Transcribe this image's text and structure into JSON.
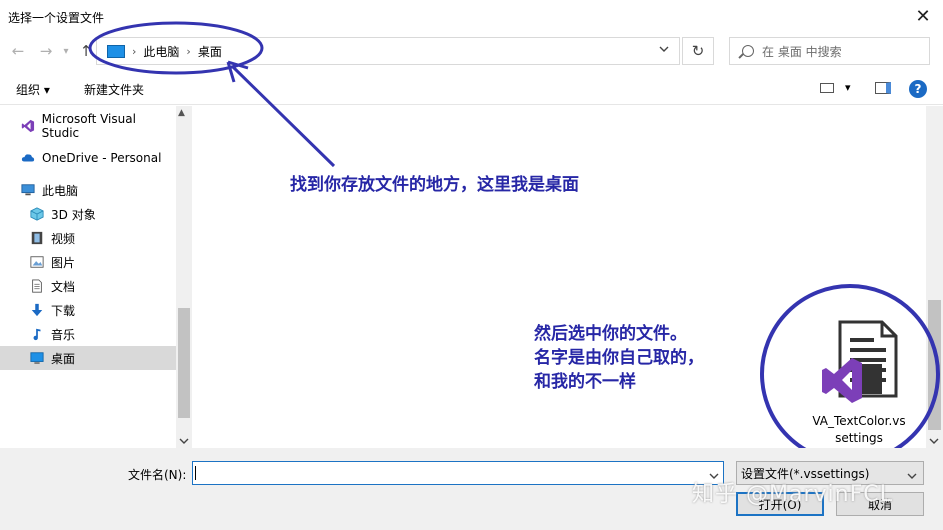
{
  "window": {
    "title": "选择一个设置文件",
    "close": "✕"
  },
  "nav": {
    "back": "←",
    "forward": "→",
    "recent": "▾",
    "up": "↑"
  },
  "address": {
    "crumbs": [
      "此电脑",
      "桌面"
    ],
    "sep": "›"
  },
  "search": {
    "placeholder": "在 桌面 中搜索"
  },
  "toolbar": {
    "organize": "组织 ▾",
    "new_folder": "新建文件夹",
    "view_menu": "▾",
    "help": "?"
  },
  "sidebar": {
    "items": [
      {
        "label": "Microsoft Visual Studic",
        "icon": "visual-studio-icon"
      },
      {
        "label": "OneDrive - Personal",
        "icon": "cloud-icon"
      },
      {
        "label": "此电脑",
        "icon": "computer-icon"
      },
      {
        "label": "3D 对象",
        "icon": "cube-icon"
      },
      {
        "label": "视频",
        "icon": "video-icon"
      },
      {
        "label": "图片",
        "icon": "picture-icon"
      },
      {
        "label": "文档",
        "icon": "document-icon"
      },
      {
        "label": "下载",
        "icon": "download-icon"
      },
      {
        "label": "音乐",
        "icon": "music-icon"
      },
      {
        "label": "桌面",
        "icon": "desktop-icon"
      }
    ],
    "selected": "桌面"
  },
  "annotations": {
    "a1": "找到你存放文件的地方，这里我是桌面",
    "a2_l1": "然后选中你的文件。",
    "a2_l2": "名字是由你自己取的，",
    "a2_l3": "和我的不一样"
  },
  "file": {
    "name_l1": "VA_TextColor.vs",
    "name_l2": "settings"
  },
  "bottom": {
    "filename_label": "文件名(N):",
    "filename_value": "",
    "filter": "设置文件(*.vssettings)",
    "open": "打开(O)",
    "cancel": "取消"
  },
  "watermark": "知乎 @MarvinFCL",
  "colors": {
    "annotation": "#2727a6",
    "accent": "#1b6ac4"
  }
}
